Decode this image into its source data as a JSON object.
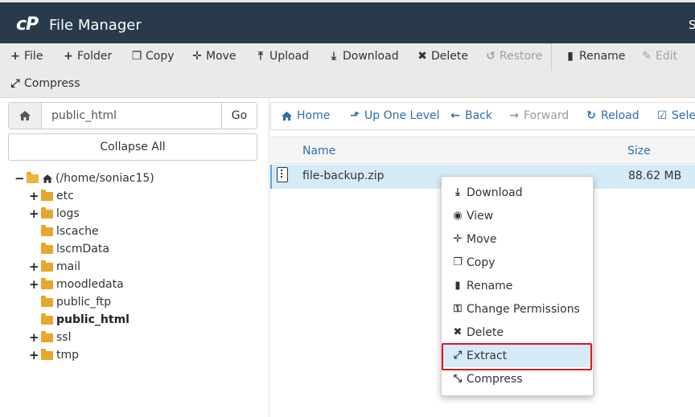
{
  "header": {
    "logo": "cP",
    "title": "File Manager",
    "right_text": "S"
  },
  "toolbar": {
    "file": "File",
    "folder": "Folder",
    "copy": "Copy",
    "move": "Move",
    "upload": "Upload",
    "download": "Download",
    "delete": "Delete",
    "restore": "Restore",
    "rename": "Rename",
    "edit": "Edit",
    "compress": "Compress"
  },
  "sidebar": {
    "path_value": "public_html",
    "go_label": "Go",
    "collapse_label": "Collapse All",
    "tree": {
      "root": "(/home/soniac15)",
      "items": [
        {
          "label": "etc",
          "expandable": true
        },
        {
          "label": "logs",
          "expandable": true
        },
        {
          "label": "lscache",
          "expandable": false
        },
        {
          "label": "lscmData",
          "expandable": false
        },
        {
          "label": "mail",
          "expandable": true
        },
        {
          "label": "moodledata",
          "expandable": true
        },
        {
          "label": "public_ftp",
          "expandable": false
        },
        {
          "label": "public_html",
          "expandable": false,
          "selected": true
        },
        {
          "label": "ssl",
          "expandable": true
        },
        {
          "label": "tmp",
          "expandable": true
        }
      ]
    }
  },
  "navbar": {
    "home": "Home",
    "up": "Up One Level",
    "back": "Back",
    "forward": "Forward",
    "reload": "Reload",
    "select": "Selec"
  },
  "table": {
    "col_name": "Name",
    "col_size": "Size",
    "rows": [
      {
        "name": "file-backup.zip",
        "size": "88.62 MB"
      }
    ]
  },
  "context_menu": {
    "items": [
      "Download",
      "View",
      "Move",
      "Copy",
      "Rename",
      "Change Permissions",
      "Delete",
      "Extract",
      "Compress"
    ],
    "highlighted": "Extract"
  },
  "colors": {
    "header_bg": "#293a4a",
    "link_blue": "#2f6fad",
    "folder": "#e8a72b",
    "selection": "#d6ebf8",
    "highlight_border": "#d9191f"
  }
}
